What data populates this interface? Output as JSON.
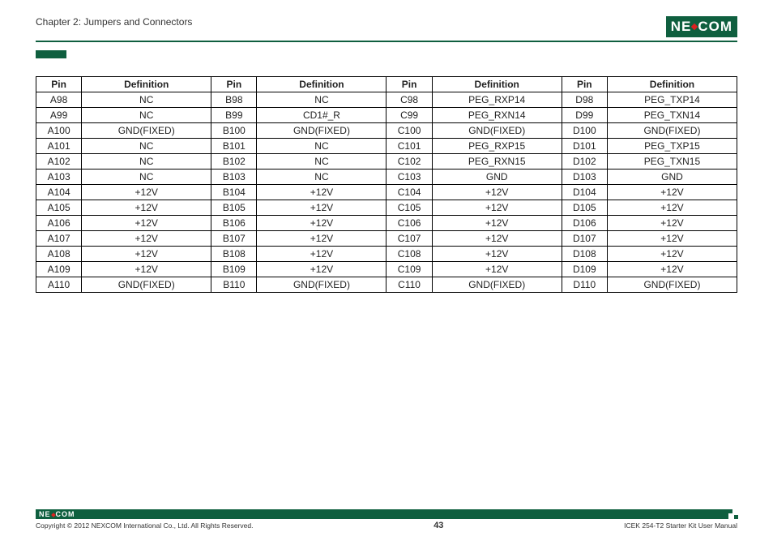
{
  "header": {
    "chapter": "Chapter 2: Jumpers and Connectors",
    "logo_left": "NE",
    "logo_right": "COM"
  },
  "chart_data": {
    "type": "table",
    "columns": [
      "Pin",
      "Definition",
      "Pin",
      "Definition",
      "Pin",
      "Definition",
      "Pin",
      "Definition"
    ],
    "rows": [
      [
        "A98",
        "NC",
        "B98",
        "NC",
        "C98",
        "PEG_RXP14",
        "D98",
        "PEG_TXP14"
      ],
      [
        "A99",
        "NC",
        "B99",
        "CD1#_R",
        "C99",
        "PEG_RXN14",
        "D99",
        "PEG_TXN14"
      ],
      [
        "A100",
        "GND(FIXED)",
        "B100",
        "GND(FIXED)",
        "C100",
        "GND(FIXED)",
        "D100",
        "GND(FIXED)"
      ],
      [
        "A101",
        "NC",
        "B101",
        "NC",
        "C101",
        "PEG_RXP15",
        "D101",
        "PEG_TXP15"
      ],
      [
        "A102",
        "NC",
        "B102",
        "NC",
        "C102",
        "PEG_RXN15",
        "D102",
        "PEG_TXN15"
      ],
      [
        "A103",
        "NC",
        "B103",
        "NC",
        "C103",
        "GND",
        "D103",
        "GND"
      ],
      [
        "A104",
        "+12V",
        "B104",
        "+12V",
        "C104",
        "+12V",
        "D104",
        "+12V"
      ],
      [
        "A105",
        "+12V",
        "B105",
        "+12V",
        "C105",
        "+12V",
        "D105",
        "+12V"
      ],
      [
        "A106",
        "+12V",
        "B106",
        "+12V",
        "C106",
        "+12V",
        "D106",
        "+12V"
      ],
      [
        "A107",
        "+12V",
        "B107",
        "+12V",
        "C107",
        "+12V",
        "D107",
        "+12V"
      ],
      [
        "A108",
        "+12V",
        "B108",
        "+12V",
        "C108",
        "+12V",
        "D108",
        "+12V"
      ],
      [
        "A109",
        "+12V",
        "B109",
        "+12V",
        "C109",
        "+12V",
        "D109",
        "+12V"
      ],
      [
        "A110",
        "GND(FIXED)",
        "B110",
        "GND(FIXED)",
        "C110",
        "GND(FIXED)",
        "D110",
        "GND(FIXED)"
      ]
    ]
  },
  "footer": {
    "logo_left": "NE",
    "logo_right": "COM",
    "copyright": "Copyright © 2012 NEXCOM International Co., Ltd. All Rights Reserved.",
    "page": "43",
    "manual": "ICEK 254-T2 Starter Kit User Manual"
  }
}
